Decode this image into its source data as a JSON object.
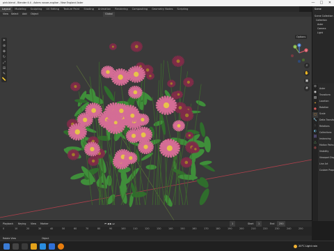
{
  "window": {
    "title": "pink.blend - Blender 4.4 - Asters novae-angliae - New England Aster",
    "controls": [
      "—",
      "□",
      "✕"
    ]
  },
  "workspace_tabs": [
    {
      "label": "Layout",
      "active": true
    },
    {
      "label": "Modeling",
      "active": false
    },
    {
      "label": "Sculpting",
      "active": false
    },
    {
      "label": "UV Editing",
      "active": false
    },
    {
      "label": "Texture Paint",
      "active": false
    },
    {
      "label": "Shading",
      "active": false
    },
    {
      "label": "Animation",
      "active": false
    },
    {
      "label": "Rendering",
      "active": false
    },
    {
      "label": "Compositing",
      "active": false
    },
    {
      "label": "Geometry Nodes",
      "active": false
    },
    {
      "label": "Scripting",
      "active": false
    }
  ],
  "header": {
    "view": "View",
    "select": "Select",
    "add": "Add",
    "object": "Object",
    "orientation": "Global",
    "scene_label": "Scene"
  },
  "viewport": {
    "options_label": "Options",
    "gizmo_axes": [
      "X",
      "Y",
      "Z"
    ]
  },
  "outliner": {
    "rows": [
      "Scene Collection",
      "Collection",
      "Aster",
      "Camera",
      "Light"
    ]
  },
  "properties": {
    "rows": [
      "Aster",
      "Transform",
      "Location",
      "Rotation",
      "Scale",
      "Delta Transform",
      "Relations",
      "Collections",
      "Instancing",
      "Motion Paths",
      "Visibility",
      "Viewport Display",
      "Line Art",
      "Custom Properties"
    ]
  },
  "timeline": {
    "playback": "Playback",
    "keying": "Keying",
    "view": "View",
    "marker": "Marker",
    "current_frame": "1",
    "start_label": "Start",
    "start": "1",
    "end_label": "End",
    "end": "250",
    "ticks": [
      "0",
      "10",
      "20",
      "30",
      "40",
      "50",
      "60",
      "70",
      "80",
      "90",
      "100",
      "110",
      "120",
      "130",
      "140",
      "150",
      "160",
      "170",
      "180",
      "190",
      "200",
      "210",
      "220",
      "230",
      "240",
      "250"
    ]
  },
  "statusbar": {
    "left": "Rotate View",
    "middle": "Object"
  },
  "taskbar": {
    "weather": "20°C Light rain"
  },
  "colors": {
    "viewport_bg": "#3a3a3a",
    "x_axis": "#b0404c",
    "y_axis": "#7aa33a",
    "petal": "#d46d95",
    "petal_dark": "#7f2c48",
    "center": "#e7c34a",
    "leaf": "#3f8e3a",
    "accent": "#4772b3"
  }
}
